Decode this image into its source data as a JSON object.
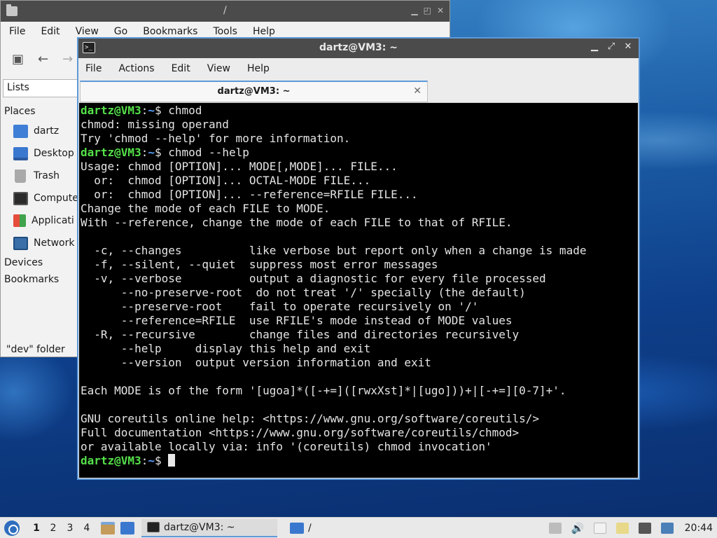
{
  "file_manager": {
    "title": "/",
    "menu": [
      "File",
      "Edit",
      "View",
      "Go",
      "Bookmarks",
      "Tools",
      "Help"
    ],
    "toolbar_icons": [
      "new-tab-icon",
      "back-icon",
      "forward-icon"
    ],
    "side_pane_mode": "Lists",
    "places_header": "Places",
    "places": [
      {
        "label": "dartz",
        "icon": "home-folder-icon"
      },
      {
        "label": "Desktop",
        "icon": "desktop-icon"
      },
      {
        "label": "Trash",
        "icon": "trash-icon"
      },
      {
        "label": "Compute",
        "icon": "computer-icon"
      },
      {
        "label": "Applicati",
        "icon": "applications-icon"
      },
      {
        "label": "Network",
        "icon": "network-icon"
      }
    ],
    "devices_header": "Devices",
    "bookmarks_header": "Bookmarks",
    "status": "\"dev\" folder"
  },
  "terminal": {
    "title": "dartz@VM3: ~",
    "menu": [
      "File",
      "Actions",
      "Edit",
      "View",
      "Help"
    ],
    "tab_label": "dartz@VM3: ~",
    "prompt_user": "dartz@VM3",
    "prompt_sep": ":",
    "prompt_path": "~",
    "prompt_dollar": "$ ",
    "lines": [
      {
        "type": "cmd",
        "text": "chmod"
      },
      {
        "type": "out",
        "text": "chmod: missing operand"
      },
      {
        "type": "out",
        "text": "Try 'chmod --help' for more information."
      },
      {
        "type": "cmd",
        "text": "chmod --help"
      },
      {
        "type": "out",
        "text": "Usage: chmod [OPTION]... MODE[,MODE]... FILE..."
      },
      {
        "type": "out",
        "text": "  or:  chmod [OPTION]... OCTAL-MODE FILE..."
      },
      {
        "type": "out",
        "text": "  or:  chmod [OPTION]... --reference=RFILE FILE..."
      },
      {
        "type": "out",
        "text": "Change the mode of each FILE to MODE."
      },
      {
        "type": "out",
        "text": "With --reference, change the mode of each FILE to that of RFILE."
      },
      {
        "type": "out",
        "text": ""
      },
      {
        "type": "out",
        "text": "  -c, --changes          like verbose but report only when a change is made"
      },
      {
        "type": "out",
        "text": "  -f, --silent, --quiet  suppress most error messages"
      },
      {
        "type": "out",
        "text": "  -v, --verbose          output a diagnostic for every file processed"
      },
      {
        "type": "out",
        "text": "      --no-preserve-root  do not treat '/' specially (the default)"
      },
      {
        "type": "out",
        "text": "      --preserve-root    fail to operate recursively on '/'"
      },
      {
        "type": "out",
        "text": "      --reference=RFILE  use RFILE's mode instead of MODE values"
      },
      {
        "type": "out",
        "text": "  -R, --recursive        change files and directories recursively"
      },
      {
        "type": "out",
        "text": "      --help     display this help and exit"
      },
      {
        "type": "out",
        "text": "      --version  output version information and exit"
      },
      {
        "type": "out",
        "text": ""
      },
      {
        "type": "out",
        "text": "Each MODE is of the form '[ugoa]*([-+=]([rwxXst]*|[ugo]))+|[-+=][0-7]+'."
      },
      {
        "type": "out",
        "text": ""
      },
      {
        "type": "out",
        "text": "GNU coreutils online help: <https://www.gnu.org/software/coreutils/>"
      },
      {
        "type": "out",
        "text": "Full documentation <https://www.gnu.org/software/coreutils/chmod>"
      },
      {
        "type": "out",
        "text": "or available locally via: info '(coreutils) chmod invocation'"
      },
      {
        "type": "prompt",
        "text": ""
      }
    ],
    "colors": {
      "user": "#55e04a",
      "path": "#5aa2ff",
      "bg": "#000000",
      "fg": "#e4e4e4"
    }
  },
  "taskbar": {
    "workspaces": [
      "1",
      "2",
      "3",
      "4"
    ],
    "active_workspace": "1",
    "tasks": [
      {
        "label": "dartz@VM3: ~",
        "icon": "terminal-icon"
      },
      {
        "label": "/",
        "icon": "folder-icon"
      }
    ],
    "clock": "20:44"
  }
}
